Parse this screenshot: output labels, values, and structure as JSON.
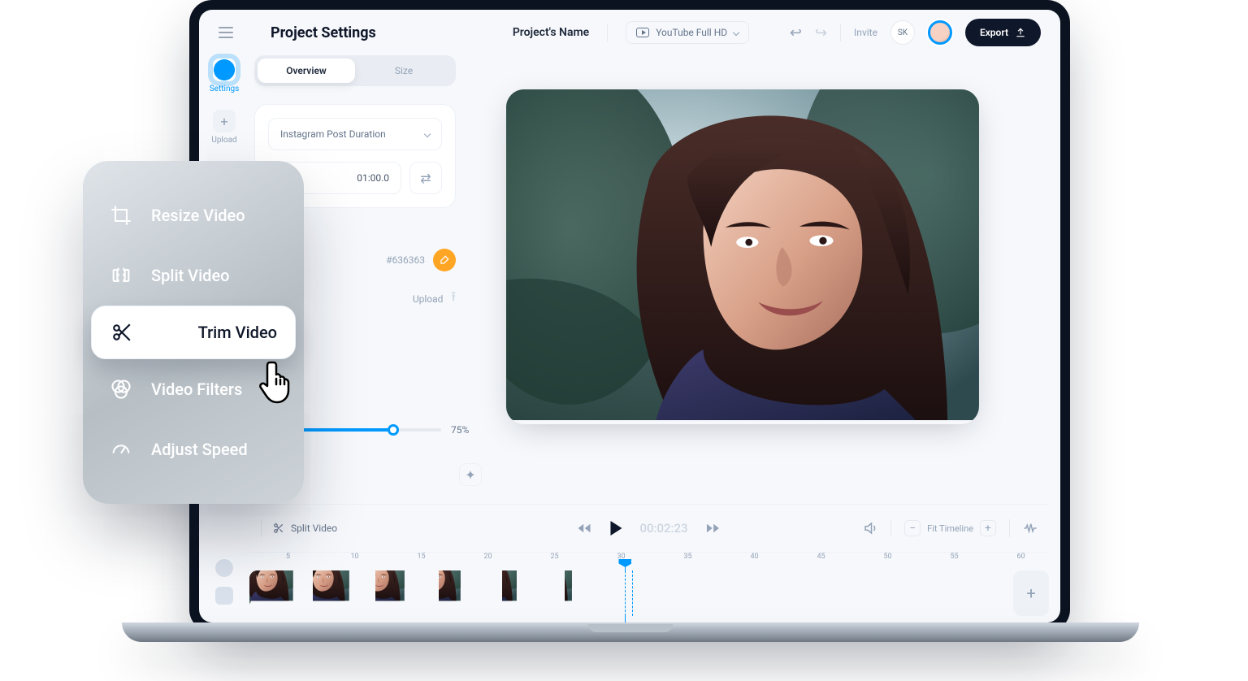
{
  "header": {
    "title": "Project Settings",
    "project_name": "Project's Name",
    "format": "YouTube Full HD",
    "invite": "Invite",
    "initials": "SK",
    "export": "Export"
  },
  "rail": {
    "settings": "Settings",
    "upload": "Upload"
  },
  "segment": {
    "overview": "Overview",
    "size": "Size"
  },
  "duration_card": {
    "preset": "Instagram Post Duration",
    "time": "01:00.0"
  },
  "color": {
    "hex": "#636363",
    "upload": "Upload"
  },
  "slider": {
    "value": "75%"
  },
  "playbar": {
    "split": "Split Video",
    "time_done": "00:02:",
    "time_rest": "23",
    "fit": "Fit Timeline"
  },
  "ruler": [
    "5",
    "10",
    "15",
    "20",
    "25",
    "30",
    "35",
    "40",
    "45",
    "50",
    "55",
    "60"
  ],
  "tools": {
    "resize": "Resize Video",
    "split": "Split Video",
    "trim": "Trim Video",
    "filters": "Video Filters",
    "speed": "Adjust Speed"
  }
}
